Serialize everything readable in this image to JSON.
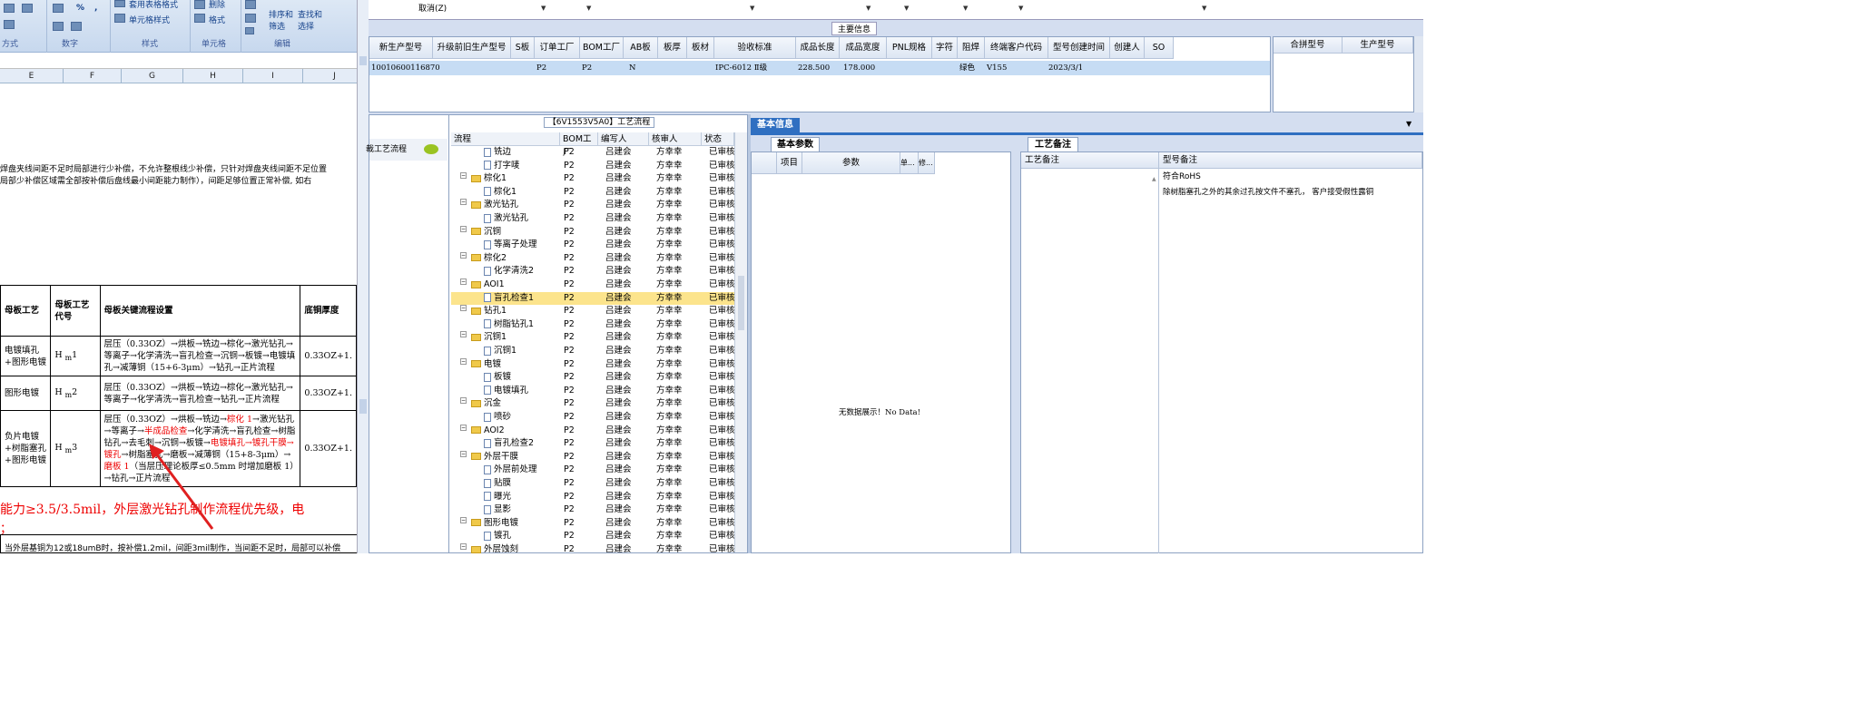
{
  "ribbon": {
    "group1": {
      "label": "方式"
    },
    "group2": {
      "label": "数字",
      "percent": "%",
      "comma": ","
    },
    "group3": {
      "label": "样式",
      "cond_format": "套用表格格式",
      "cell_style": "单元格样式"
    },
    "group4": {
      "label": "单元格",
      "delete": "删除",
      "format": "格式"
    },
    "group5": {
      "label": "编辑",
      "sort": "排序和\n筛选",
      "sort_line1": "排序和",
      "sort_line2": "筛选",
      "find_line1": "查找和",
      "find_line2": "选择"
    }
  },
  "sheet": {
    "columns": [
      "E",
      "F",
      "G",
      "H",
      "I",
      "J"
    ],
    "note_line1": "焊盘夹线间距不足时局部进行少补偿，不允许整根线少补偿，只针对焊盘夹线间距不足位置",
    "note_line2": "局部少补偿区域需全部按补偿后盘线最小间距能力制作），间距足够位置正常补偿, 如右",
    "table": {
      "headers": [
        "母板工艺",
        "母板工艺代号",
        "母板关键流程设置",
        "底铜厚度"
      ],
      "rows": [
        {
          "process": "电镀填孔+图形电镀",
          "code": "H",
          "code_sub": "m",
          "code_num": "1",
          "flow": "层压（0.33OZ）→烘板→铣边→棕化→激光钻孔→等离子→化学清洗→盲孔检查→沉铜→板镀→电镀填孔→减薄铜（15+6-3μm）→钻孔→正片流程",
          "copper": "0.33OZ+1."
        },
        {
          "process": "图形电镀",
          "code": "H",
          "code_sub": "m",
          "code_num": "2",
          "flow": "层压（0.33OZ）→烘板→铣边→棕化→激光钻孔→等离子→化学清洗→盲孔检查→钻孔→正片流程",
          "copper": "0.33OZ+1."
        },
        {
          "process": "负片电镀+树脂塞孔+图形电镀",
          "code": "H",
          "code_sub": "m",
          "code_num": "3",
          "flow_a": "层压（0.33OZ）→烘板→铣边→",
          "flow_b": "棕化 1",
          "flow_c": "→激光钻孔→等离子→",
          "flow_d": "半成品检查",
          "flow_e": "→化学清洗→盲孔检查→树脂钻孔→去毛刺→沉铜→板镀→",
          "flow_f": "电镀填孔→镀孔干膜→镀孔",
          "flow_g": "→树脂塞孔→磨板→减薄铜（15+8-3μm）→",
          "flow_h": "磨板 1",
          "flow_i": "（当层压理论板厚≤0.5mm 时增加磨板 1）→钻孔→正片流程",
          "copper": "0.33OZ+1."
        }
      ]
    },
    "red_line1": "能力≥3.5/3.5mil，外层激光钻孔制作流程优先级，电",
    "red_line2": "；",
    "bottom_text": "当外层基铜为12或18umB时，按补偿1.2mil，间距3mil制作，当间距不足时，局部可以补偿"
  },
  "topbar": {
    "cancel": "取消(Z)"
  },
  "main_info": {
    "title": "主要信息",
    "headers": [
      "新生产型号",
      "升级前旧生产型号",
      "S板",
      "订单工厂",
      "BOM工厂",
      "AB板",
      "板厚",
      "板材",
      "验收标准",
      "成品长度",
      "成品宽度",
      "PNL规格",
      "字符",
      "阻焊",
      "终端客户代码",
      "型号创建时间",
      "创建人",
      "SO"
    ],
    "row": {
      "model": "10010600116870",
      "order_factory": "P2",
      "bom_factory": "P2",
      "ab": "N",
      "standard": "IPC-6012 Ⅱ级",
      "length": "228.500",
      "width": "178.000",
      "solder": "绿色",
      "customer": "V155",
      "created": "2023/3/1"
    },
    "side_headers": [
      "合拼型号",
      "生产型号"
    ]
  },
  "flow_panel": {
    "title": "【6V1553V5A0】工艺流程",
    "left_label": "裁工艺流程",
    "headers": [
      "流程",
      "BOM工厂",
      "编写人",
      "核审人",
      "状态"
    ],
    "rows": [
      {
        "type": "doc",
        "name": "铣边",
        "bom": "P2",
        "writer": "吕建会",
        "reviewer": "方幸幸",
        "status": "已审核"
      },
      {
        "type": "doc",
        "name": "打字唛",
        "bom": "P2",
        "writer": "吕建会",
        "reviewer": "方幸幸",
        "status": "已审核"
      },
      {
        "type": "folder",
        "name": "棕化1",
        "bom": "P2",
        "writer": "吕建会",
        "reviewer": "方幸幸",
        "status": "已审核"
      },
      {
        "type": "doc",
        "name": "棕化1",
        "bom": "P2",
        "writer": "吕建会",
        "reviewer": "方幸幸",
        "status": "已审核"
      },
      {
        "type": "folder",
        "name": "激光钻孔",
        "bom": "P2",
        "writer": "吕建会",
        "reviewer": "方幸幸",
        "status": "已审核"
      },
      {
        "type": "doc",
        "name": "激光钻孔",
        "bom": "P2",
        "writer": "吕建会",
        "reviewer": "方幸幸",
        "status": "已审核"
      },
      {
        "type": "folder",
        "name": "沉铜",
        "bom": "P2",
        "writer": "吕建会",
        "reviewer": "方幸幸",
        "status": "已审核"
      },
      {
        "type": "doc",
        "name": "等离子处理",
        "bom": "P2",
        "writer": "吕建会",
        "reviewer": "方幸幸",
        "status": "已审核"
      },
      {
        "type": "folder",
        "name": "棕化2",
        "bom": "P2",
        "writer": "吕建会",
        "reviewer": "方幸幸",
        "status": "已审核"
      },
      {
        "type": "doc",
        "name": "化学清洗2",
        "bom": "P2",
        "writer": "吕建会",
        "reviewer": "方幸幸",
        "status": "已审核"
      },
      {
        "type": "folder",
        "name": "AOI1",
        "bom": "P2",
        "writer": "吕建会",
        "reviewer": "方幸幸",
        "status": "已审核"
      },
      {
        "type": "doc",
        "name": "盲孔检查1",
        "bom": "P2",
        "writer": "吕建会",
        "reviewer": "方幸幸",
        "status": "已审核",
        "selected": true
      },
      {
        "type": "folder",
        "name": "钻孔1",
        "bom": "P2",
        "writer": "吕建会",
        "reviewer": "方幸幸",
        "status": "已审核"
      },
      {
        "type": "doc",
        "name": "树脂钻孔1",
        "bom": "P2",
        "writer": "吕建会",
        "reviewer": "方幸幸",
        "status": "已审核"
      },
      {
        "type": "folder",
        "name": "沉铜1",
        "bom": "P2",
        "writer": "吕建会",
        "reviewer": "方幸幸",
        "status": "已审核"
      },
      {
        "type": "doc",
        "name": "沉铜1",
        "bom": "P2",
        "writer": "吕建会",
        "reviewer": "方幸幸",
        "status": "已审核"
      },
      {
        "type": "folder",
        "name": "电镀",
        "bom": "P2",
        "writer": "吕建会",
        "reviewer": "方幸幸",
        "status": "已审核"
      },
      {
        "type": "doc",
        "name": "板镀",
        "bom": "P2",
        "writer": "吕建会",
        "reviewer": "方幸幸",
        "status": "已审核"
      },
      {
        "type": "doc",
        "name": "电镀填孔",
        "bom": "P2",
        "writer": "吕建会",
        "reviewer": "方幸幸",
        "status": "已审核"
      },
      {
        "type": "folder",
        "name": "沉金",
        "bom": "P2",
        "writer": "吕建会",
        "reviewer": "方幸幸",
        "status": "已审核"
      },
      {
        "type": "doc",
        "name": "喷砂",
        "bom": "P2",
        "writer": "吕建会",
        "reviewer": "方幸幸",
        "status": "已审核"
      },
      {
        "type": "folder",
        "name": "AOI2",
        "bom": "P2",
        "writer": "吕建会",
        "reviewer": "方幸幸",
        "status": "已审核"
      },
      {
        "type": "doc",
        "name": "盲孔检查2",
        "bom": "P2",
        "writer": "吕建会",
        "reviewer": "方幸幸",
        "status": "已审核"
      },
      {
        "type": "folder",
        "name": "外层干膜",
        "bom": "P2",
        "writer": "吕建会",
        "reviewer": "方幸幸",
        "status": "已审核"
      },
      {
        "type": "doc",
        "name": "外层前处理",
        "bom": "P2",
        "writer": "吕建会",
        "reviewer": "方幸幸",
        "status": "已审核"
      },
      {
        "type": "doc",
        "name": "贴膜",
        "bom": "P2",
        "writer": "吕建会",
        "reviewer": "方幸幸",
        "status": "已审核"
      },
      {
        "type": "doc",
        "name": "曝光",
        "bom": "P2",
        "writer": "吕建会",
        "reviewer": "方幸幸",
        "status": "已审核"
      },
      {
        "type": "doc",
        "name": "显影",
        "bom": "P2",
        "writer": "吕建会",
        "reviewer": "方幸幸",
        "status": "已审核"
      },
      {
        "type": "folder",
        "name": "图形电镀",
        "bom": "P2",
        "writer": "吕建会",
        "reviewer": "方幸幸",
        "status": "已审核"
      },
      {
        "type": "doc",
        "name": "镀孔",
        "bom": "P2",
        "writer": "吕建会",
        "reviewer": "方幸幸",
        "status": "已审核"
      },
      {
        "type": "folder",
        "name": "外层蚀刻",
        "bom": "P2",
        "writer": "吕建会",
        "reviewer": "方幸幸",
        "status": "已审核"
      }
    ]
  },
  "basic_info": {
    "tab": "基本信息",
    "sub_tab": "基本参数",
    "headers": [
      "项目",
      "参数",
      "单...",
      "修..."
    ],
    "empty": "无数据展示！No Data!"
  },
  "process_notes": {
    "tab": "工艺备注",
    "col1": "工艺备注",
    "col2": "型号备注",
    "line1": "符合RoHS",
    "line2": "除树脂塞孔之外的其余过孔按文件不塞孔， 客户接受假性露铜"
  },
  "colors": {
    "selected_row": "#fce48c",
    "folder": "#f0c94a",
    "annotation_arrow": "#e02020"
  }
}
